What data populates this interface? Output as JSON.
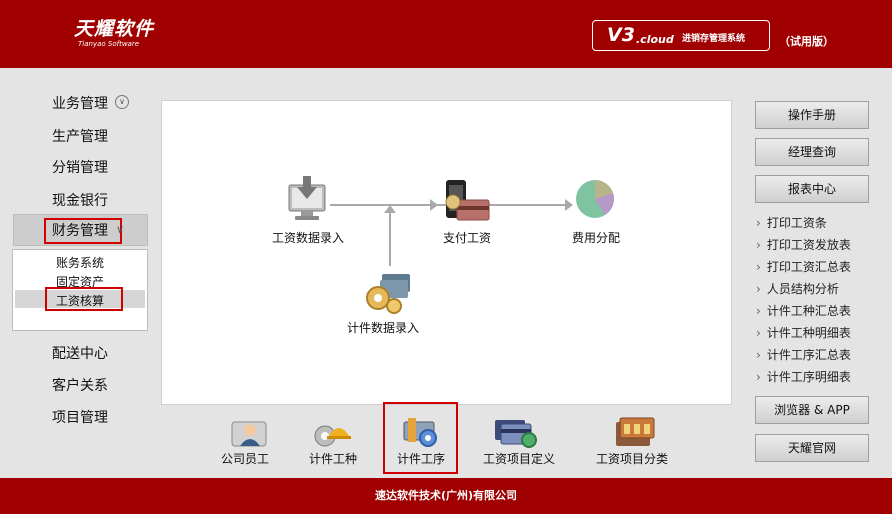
{
  "header": {
    "logo_main": "天耀软件",
    "logo_sub": "Tianyao Software",
    "version": "V3",
    "version_suffix": ".cloud",
    "product_name": "进销存管理系统",
    "trial": "（试用版）"
  },
  "left_nav": {
    "items": [
      {
        "label": "业务管理"
      },
      {
        "label": "生产管理"
      },
      {
        "label": "分销管理"
      },
      {
        "label": "现金银行"
      },
      {
        "label": "财务管理"
      },
      {
        "label": "配送中心"
      },
      {
        "label": "客户关系"
      },
      {
        "label": "项目管理"
      }
    ],
    "finance_sub": [
      {
        "label": "账务系统"
      },
      {
        "label": "固定资产"
      },
      {
        "label": "工资核算"
      }
    ]
  },
  "flow": {
    "salary_entry": "工资数据录入",
    "pay_salary": "支付工资",
    "cost_alloc": "费用分配",
    "piece_entry": "计件数据录入"
  },
  "tools": [
    {
      "label": "公司员工"
    },
    {
      "label": "计件工种"
    },
    {
      "label": "计件工序"
    },
    {
      "label": "工资项目定义"
    },
    {
      "label": "工资项目分类"
    }
  ],
  "right": {
    "buttons": {
      "manual": "操作手册",
      "manager": "经理查询",
      "reports": "报表中心",
      "browser": "浏览器 & APP",
      "official": "天耀官网"
    },
    "links": [
      "打印工资条",
      "打印工资发放表",
      "打印工资汇总表",
      "人员结构分析",
      "计件工种汇总表",
      "计件工种明细表",
      "计件工序汇总表",
      "计件工序明细表"
    ]
  },
  "footer": {
    "text": "速达软件技术(广州)有限公司"
  },
  "colors": {
    "brand_red": "#a00000",
    "highlight_red": "#d00000"
  }
}
